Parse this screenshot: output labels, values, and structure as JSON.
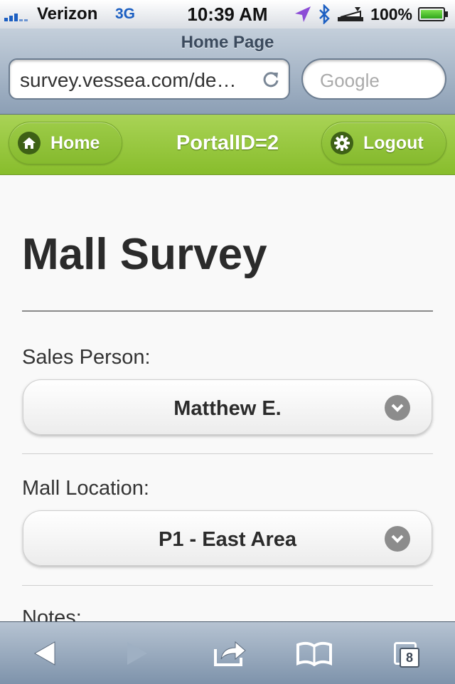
{
  "status_bar": {
    "carrier": "Verizon",
    "network": "3G",
    "time": "10:39 AM",
    "battery": "100%",
    "icons": [
      "signal-icon",
      "location-icon",
      "bluetooth-icon",
      "alarm-icon",
      "battery-icon"
    ]
  },
  "browser": {
    "page_title": "Home Page",
    "url": "survey.vessea.com/de…",
    "search_placeholder": "Google"
  },
  "header": {
    "home_label": "Home",
    "title": "PortalID=2",
    "logout_label": "Logout",
    "color": "#99c83f"
  },
  "form": {
    "title": "Mall Survey",
    "fields": [
      {
        "label": "Sales Person:",
        "value": "Matthew E."
      },
      {
        "label": "Mall Location:",
        "value": "P1 - East Area"
      }
    ],
    "next_label": "Notes:"
  },
  "toolbar": {
    "tabs_count": "8",
    "icons": [
      "back-icon",
      "forward-icon",
      "share-icon",
      "bookmarks-icon",
      "tabs-icon"
    ]
  }
}
